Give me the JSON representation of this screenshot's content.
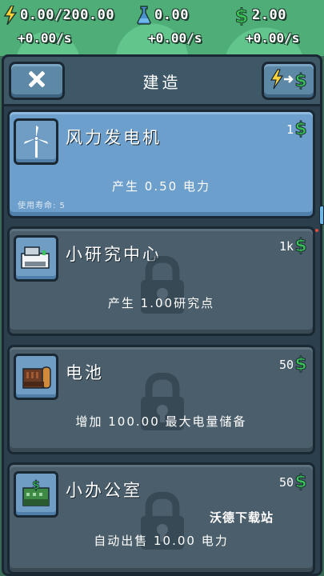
{
  "stats": {
    "energy": {
      "value": "0.00/200.00",
      "rate": "+0.00/s",
      "icon": "lightning-icon"
    },
    "research": {
      "value": "0.00",
      "rate": "+0.00/s",
      "icon": "flask-icon"
    },
    "money": {
      "value": "2.00",
      "rate": "+0.00/s",
      "icon": "dollar-icon"
    }
  },
  "header": {
    "title": "建造",
    "close_icon": "close-icon",
    "convert_icon": "energy-to-money-icon"
  },
  "buildings": [
    {
      "name": "风力发电机",
      "cost": "1",
      "desc": "产生 0.50 电力",
      "life": "使用寿命: 5",
      "locked": false,
      "icon": "wind-turbine-icon"
    },
    {
      "name": "小研究中心",
      "cost": "1k",
      "desc": "产生 1.00研究点",
      "locked": true,
      "icon": "research-center-icon"
    },
    {
      "name": "电池",
      "cost": "50",
      "desc": "增加 100.00 最大电量储备",
      "locked": true,
      "icon": "battery-icon"
    },
    {
      "name": "小办公室",
      "cost": "50",
      "desc": "自动出售 10.00 电力",
      "locked": true,
      "icon": "office-icon"
    }
  ],
  "watermark": "沃德下载站",
  "colors": {
    "money_green": "#39c456",
    "energy_yellow": "#ffd23a",
    "active_card": "#6d9fcc",
    "locked_card": "#4b5e6b"
  }
}
